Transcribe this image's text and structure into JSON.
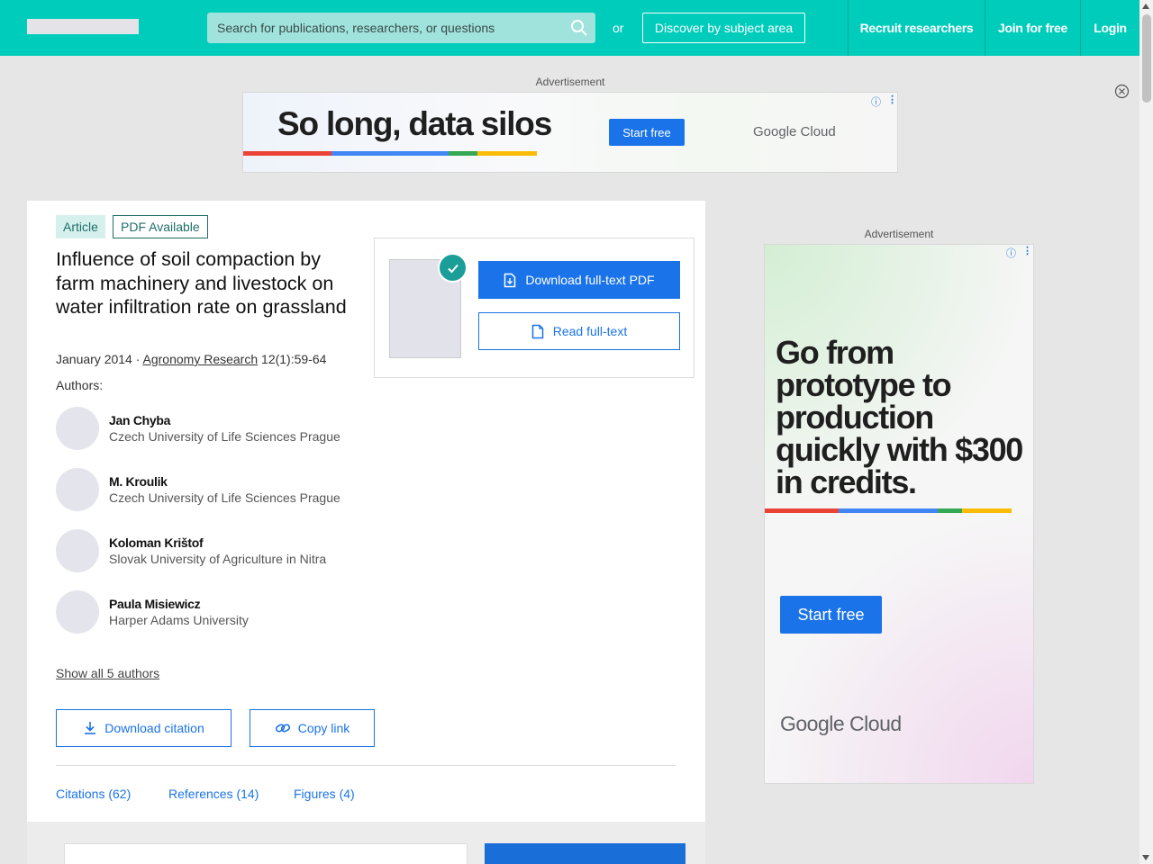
{
  "header": {
    "search_placeholder": "Search for publications, researchers, or questions",
    "or_text": "or",
    "discover_label": "Discover by subject area",
    "nav": [
      "Recruit researchers",
      "Join for free",
      "Login"
    ]
  },
  "ads": {
    "label": "Advertisement",
    "banner": {
      "headline": "So long, data silos",
      "cta": "Start free",
      "logo": "Google Cloud"
    },
    "side": {
      "headline": "Go from prototype to production quickly with $300 in credits.",
      "cta": "Start free",
      "logo": "Google Cloud"
    },
    "info_glyph": "ⓘ",
    "menu_glyph": "⋮"
  },
  "article": {
    "type_badge": "Article",
    "pdf_badge": "PDF Available",
    "title": "Influence of soil compaction by farm machinery and livestock on water infiltration rate on grassland",
    "date": "January 2014",
    "meta_sep": " · ",
    "journal": "Agronomy Research",
    "volume": " 12(1):59-64",
    "authors_label": "Authors:",
    "authors": [
      {
        "name": "Jan Chyba",
        "affiliation": "Czech University of Life Sciences Prague"
      },
      {
        "name": "M. Kroulik",
        "affiliation": "Czech University of Life Sciences Prague"
      },
      {
        "name": "Koloman Krištof",
        "affiliation": "Slovak University of Agriculture in Nitra"
      },
      {
        "name": "Paula Misiewicz",
        "affiliation": "Harper Adams University"
      }
    ],
    "show_all": "Show all 5 authors",
    "download_citation": "Download citation",
    "copy_link": "Copy link",
    "tabs": [
      "Citations (62)",
      "References (14)",
      "Figures (4)"
    ]
  },
  "pdf_panel": {
    "download_label": "Download full-text PDF",
    "read_label": "Read full-text"
  },
  "colors": {
    "brand": "#00ccbb",
    "link": "#1a73e8",
    "google_red": "#ea4335",
    "google_blue": "#4285f4",
    "google_green": "#34a853",
    "google_yellow": "#fbbc05"
  }
}
